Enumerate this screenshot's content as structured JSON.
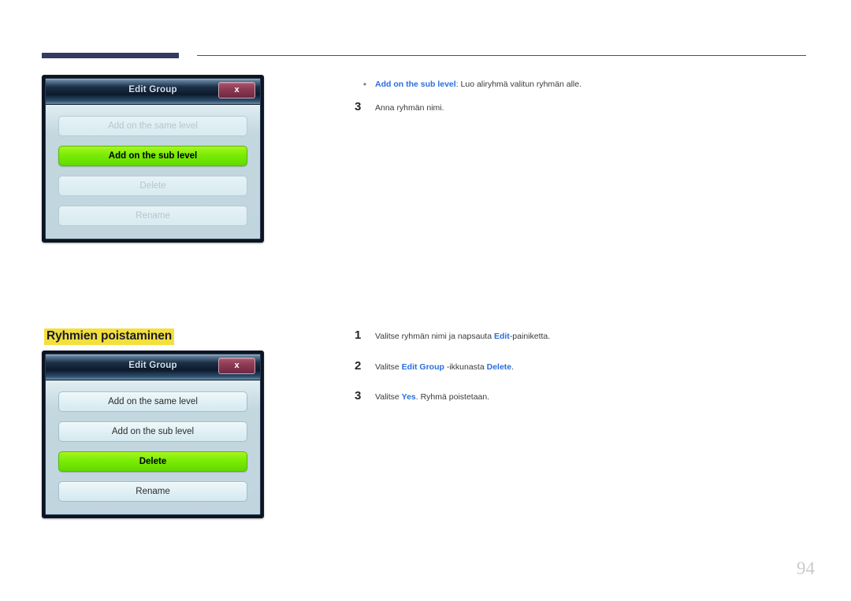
{
  "page": {
    "number": "94",
    "heading": "Ryhmien poistaminen"
  },
  "dialog_top": {
    "title": "Edit Group",
    "close_label": "x",
    "buttons": [
      {
        "label": "Add on the same level",
        "state": "disabled"
      },
      {
        "label": "Add on the sub level",
        "state": "selected"
      },
      {
        "label": "Delete",
        "state": "disabled"
      },
      {
        "label": "Rename",
        "state": "disabled"
      }
    ]
  },
  "dialog_bottom": {
    "title": "Edit Group",
    "close_label": "x",
    "buttons": [
      {
        "label": "Add on the same level",
        "state": "normal"
      },
      {
        "label": "Add on the sub level",
        "state": "normal"
      },
      {
        "label": "Delete",
        "state": "selected"
      },
      {
        "label": "Rename",
        "state": "normal"
      }
    ]
  },
  "text_top": {
    "bullet": {
      "marker": "•",
      "term": "Add on the sub level",
      "rest": ": Luo aliryhmä valitun ryhmän alle."
    },
    "step": {
      "number": "3",
      "text": "Anna ryhmän nimi."
    }
  },
  "text_bottom": {
    "steps": [
      {
        "number": "1",
        "parts": [
          {
            "t": "Valitse ryhmän nimi ja napsauta ",
            "b": false
          },
          {
            "t": "Edit",
            "b": true
          },
          {
            "t": "-painiketta.",
            "b": false
          }
        ]
      },
      {
        "number": "2",
        "parts": [
          {
            "t": "Valitse ",
            "b": false
          },
          {
            "t": "Edit Group",
            "b": true
          },
          {
            "t": " -ikkunasta ",
            "b": false
          },
          {
            "t": "Delete",
            "b": true
          },
          {
            "t": ".",
            "b": false
          }
        ]
      },
      {
        "number": "3",
        "parts": [
          {
            "t": "Valitse ",
            "b": false
          },
          {
            "t": "Yes",
            "b": true
          },
          {
            "t": ". Ryhmä poistetaan.",
            "b": false
          }
        ]
      }
    ]
  },
  "colors": {
    "rule": "#343a60",
    "highlight": "#f3e03c",
    "link_blue": "#2a6ee0",
    "selected_green": "#79ec05",
    "close_maroon": "#8e3b55"
  }
}
